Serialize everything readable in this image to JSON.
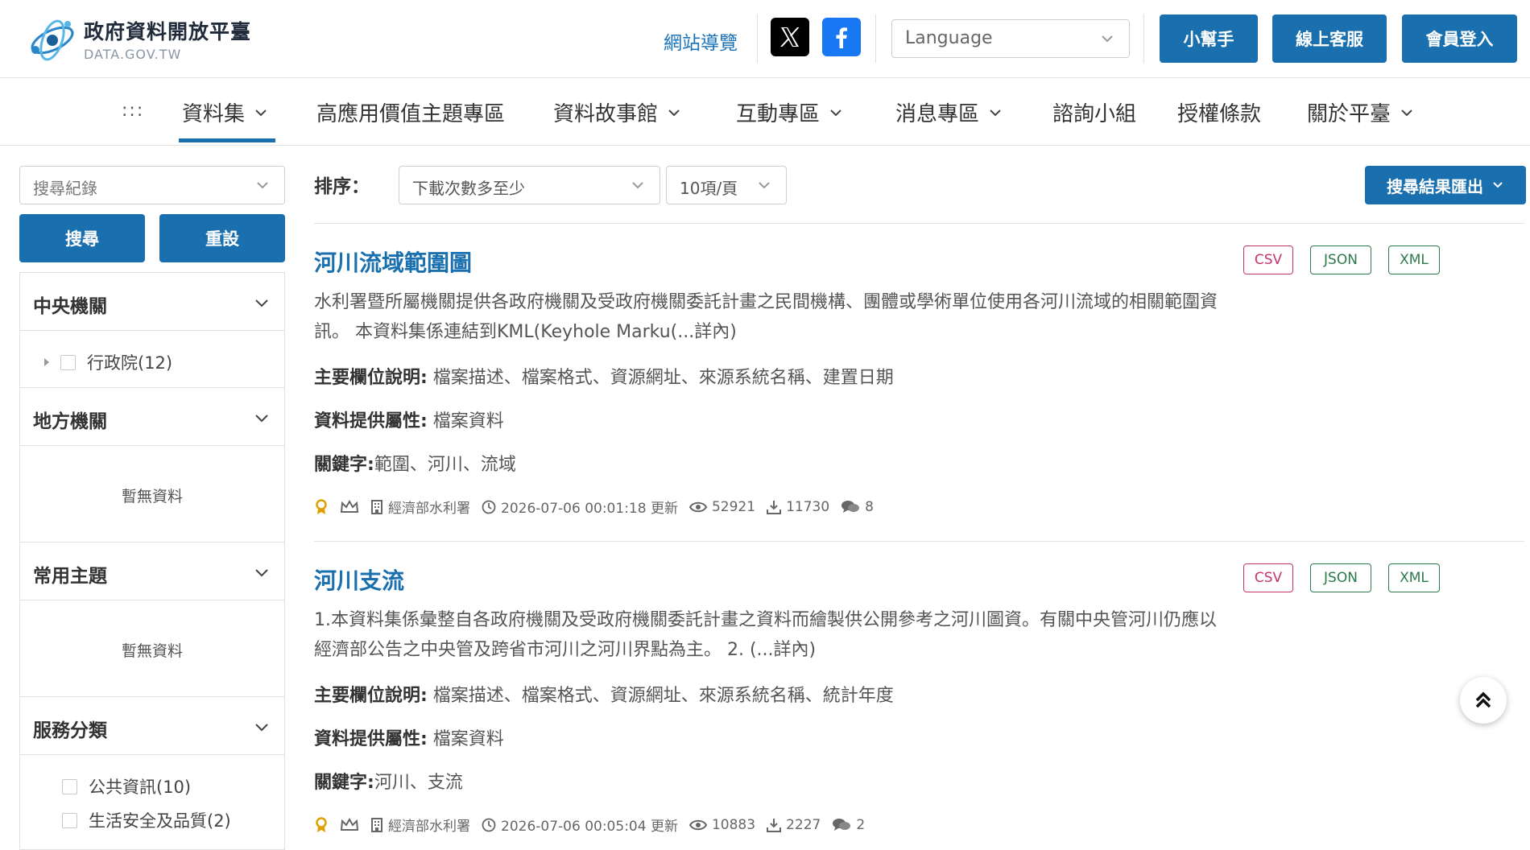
{
  "header": {
    "logo_title": "政府資料開放平臺",
    "logo_sub": "DATA.GOV.TW",
    "site_map": "網站導覽",
    "language_placeholder": "Language",
    "helper_button": "小幫手",
    "service_button": "線上客服",
    "login_button": "會員登入"
  },
  "nav": {
    "dots": ":::",
    "items": [
      {
        "label": "資料集"
      },
      {
        "label": "高應用價值主題專區"
      },
      {
        "label": "資料故事館"
      },
      {
        "label": "互動專區"
      },
      {
        "label": "消息專區"
      },
      {
        "label": "諮詢小組"
      },
      {
        "label": "授權條款"
      },
      {
        "label": "關於平臺"
      }
    ]
  },
  "sidebar": {
    "history_placeholder": "搜尋紀錄",
    "search_button": "搜尋",
    "reset_button": "重設",
    "central": {
      "title": "中央機關",
      "items": [
        {
          "label": "行政院(12)"
        }
      ]
    },
    "local": {
      "title": "地方機關",
      "empty": "暫無資料"
    },
    "topics": {
      "title": "常用主題",
      "empty": "暫無資料"
    },
    "services": {
      "title": "服務分類",
      "items": [
        {
          "label": "公共資訊(10)"
        },
        {
          "label": "生活安全及品質(2)"
        }
      ]
    }
  },
  "content": {
    "sort_label": "排序：",
    "sort_value": "下載次數多至少",
    "page_size": "10項/頁",
    "export_button": "搜尋結果匯出",
    "results": [
      {
        "title": "河川流域範圍圖",
        "desc": "水利署暨所屬機關提供各政府機關及受政府機關委託計畫之民間機構、團體或學術單位使用各河川流域的相關範圍資訊。 本資料集係連結到KML(Keyhole Marku(...詳內)",
        "fields_label": "主要欄位說明:",
        "fields": " 檔案描述、檔案格式、資源網址、來源系統名稱、建置日期",
        "attr_label": "資料提供屬性:",
        "attr": " 檔案資料",
        "kw_label": "關鍵字:",
        "kw": "範圍、河川、流域",
        "agency": "經濟部水利署",
        "updated": "2026-07-06 00:01:18 更新",
        "views": "52921",
        "downloads": "11730",
        "comments": "8",
        "formats": [
          "CSV",
          "JSON",
          "XML"
        ]
      },
      {
        "title": "河川支流",
        "desc": "1.本資料集係彙整自各政府機關及受政府機關委託計畫之資料而繪製供公開參考之河川圖資。有關中央管河川仍應以經濟部公告之中央管及跨省市河川之河川界點為主。 2. (...詳內)",
        "fields_label": "主要欄位說明:",
        "fields": " 檔案描述、檔案格式、資源網址、來源系統名稱、統計年度",
        "attr_label": "資料提供屬性:",
        "attr": " 檔案資料",
        "kw_label": "關鍵字:",
        "kw": "河川、支流",
        "agency": "經濟部水利署",
        "updated": "2026-07-06 00:05:04 更新",
        "views": "10883",
        "downloads": "2227",
        "comments": "2",
        "formats": [
          "CSV",
          "JSON",
          "XML"
        ]
      }
    ]
  },
  "colors": {
    "primary": "#1a6fae",
    "csv": "#c8336f",
    "json": "#2c7a4a",
    "xml": "#2c7a4a"
  }
}
